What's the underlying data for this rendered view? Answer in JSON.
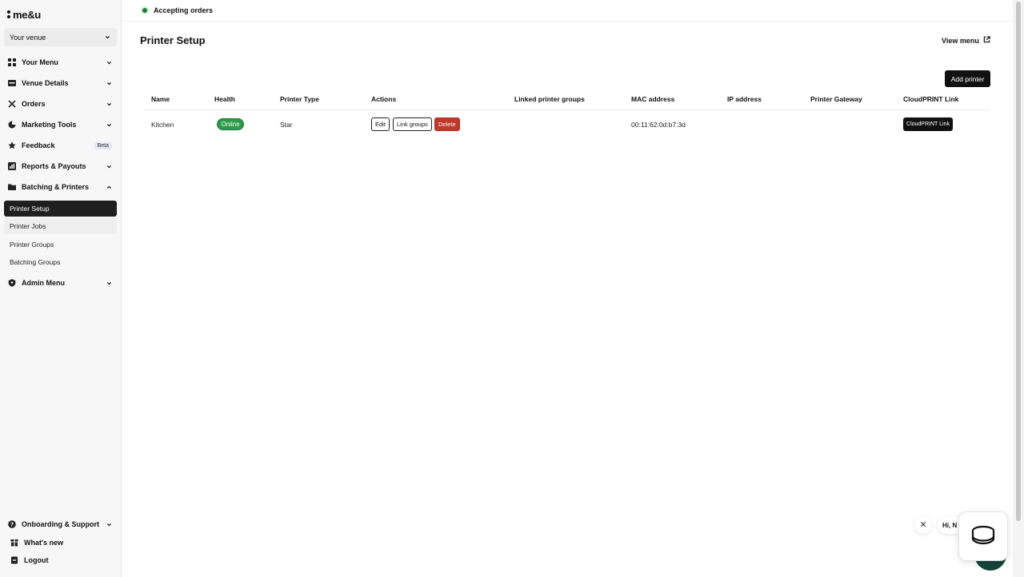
{
  "brand": {
    "name": "me&u"
  },
  "venue_selector": {
    "label": "Your venue"
  },
  "sidebar": {
    "items": [
      {
        "label": "Your Menu",
        "icon": "grid-icon"
      },
      {
        "label": "Venue Details",
        "icon": "storefront-icon"
      },
      {
        "label": "Orders",
        "icon": "utensils-icon"
      },
      {
        "label": "Marketing Tools",
        "icon": "pie-chart-icon"
      },
      {
        "label": "Feedback",
        "icon": "star-icon",
        "badge": "Beta"
      },
      {
        "label": "Reports & Payouts",
        "icon": "bar-chart-icon"
      },
      {
        "label": "Batching & Printers",
        "icon": "folder-icon"
      }
    ],
    "sub_items": [
      {
        "label": "Printer Setup",
        "active": true
      },
      {
        "label": "Printer Jobs"
      },
      {
        "label": "Printer Groups"
      },
      {
        "label": "Batching Groups"
      }
    ],
    "admin": {
      "label": "Admin Menu",
      "icon": "shield-icon"
    },
    "bottom": [
      {
        "label": "Onboarding & Support",
        "icon": "help-circle-icon"
      },
      {
        "label": "What's new",
        "icon": "gift-icon"
      },
      {
        "label": "Logout",
        "icon": "logout-icon"
      }
    ]
  },
  "topbar": {
    "status": "Accepting orders",
    "status_color": "#1e7a3c"
  },
  "page": {
    "title": "Printer Setup",
    "view_menu": "View menu",
    "add_printer": "Add printer"
  },
  "table": {
    "columns": [
      "Name",
      "Health",
      "Printer Type",
      "Actions",
      "Linked printer groups",
      "MAC address",
      "IP address",
      "Printer Gateway",
      "CloudPRINT Link"
    ],
    "rows": [
      {
        "name": "Kitchen",
        "health": "Online",
        "printer_type": "Star",
        "actions": {
          "edit": "Edit",
          "link_groups": "Link groups",
          "delete": "Delete"
        },
        "linked_groups": "",
        "mac": "00:11:62:0d:b7:3d",
        "ip": "",
        "gateway": "",
        "cloudprint": "CloudPRINT Link"
      }
    ]
  },
  "chat": {
    "greeting": "Hi, N"
  },
  "colors": {
    "accent": "#111111",
    "online": "#2e9a4a",
    "delete": "#c0392b",
    "chat_brand": "#17443a"
  }
}
